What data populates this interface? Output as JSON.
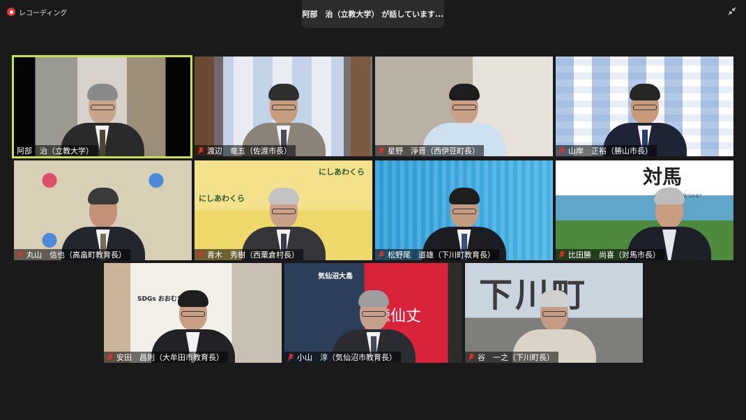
{
  "recording": {
    "label": "レコーディング"
  },
  "speaker_banner": {
    "text": "阿部　治（立教大学） が話しています..."
  },
  "participants": [
    {
      "name": "阿部　治（立教大学）",
      "muted": false,
      "active": true
    },
    {
      "name": "渡辺　竜五（佐渡市長）",
      "muted": true,
      "active": false
    },
    {
      "name": "星野　淨晋（西伊豆町長）",
      "muted": true,
      "active": false
    },
    {
      "name": "山岸　正裕（勝山市長）",
      "muted": true,
      "active": false
    },
    {
      "name": "丸山　信也（高畠町教育長）",
      "muted": true,
      "active": false
    },
    {
      "name": "青木　秀樹（西粟倉村長）",
      "muted": true,
      "active": false
    },
    {
      "name": "松野尾　道雄（下川町教育長）",
      "muted": true,
      "active": false
    },
    {
      "name": "比田勝　尚喜（対馬市長）",
      "muted": true,
      "active": false
    },
    {
      "name": "安田　昌則（大牟田市教育長）",
      "muted": true,
      "active": false
    },
    {
      "name": "小山　淳（気仙沼市教育長）",
      "muted": true,
      "active": false
    },
    {
      "name": "谷　一之（下川町長）",
      "muted": true,
      "active": false
    }
  ],
  "backgrounds": {
    "tsushima_title": "対馬",
    "tsushima_sub": "どんな生き方を見つける？",
    "nishiawakura_text": "にしあわくら",
    "shimokawa_text": "下川町",
    "kesennuma_text": "気仙沼大島",
    "kesennuma_big": "徳仙丈",
    "sdgs_text": "SDGs おおむたマップ"
  },
  "colors": {
    "active_border": "#c8e24a",
    "mute_red": "#e0312b",
    "rec_red": "#d83b2b"
  }
}
